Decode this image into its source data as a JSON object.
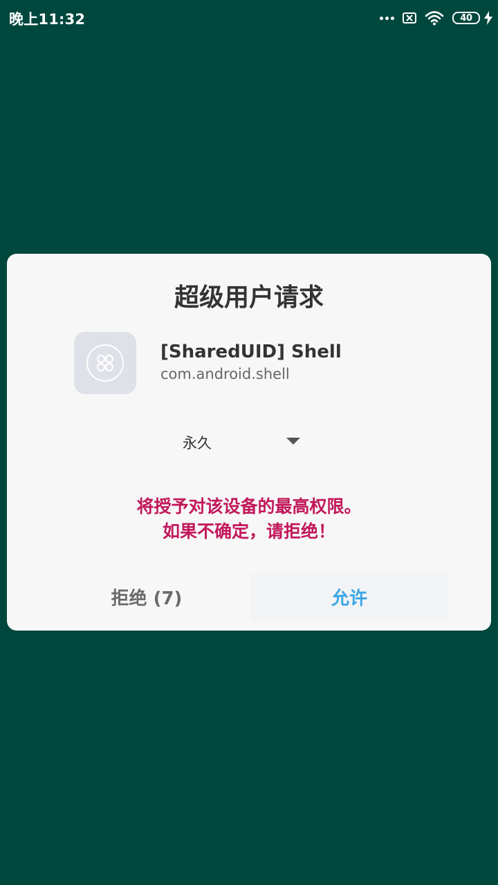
{
  "status_bar": {
    "time": "晚上11:32",
    "battery_level": "40",
    "icons": [
      "more-dots-icon",
      "sim-blocked-icon",
      "wifi-icon",
      "battery-icon",
      "charging-bolt-icon"
    ]
  },
  "dialog": {
    "title": "超级用户请求",
    "app": {
      "name": "[SharedUID] Shell",
      "package": "com.android.shell",
      "icon": "app-grid-icon"
    },
    "duration": {
      "selected": "永久"
    },
    "warning": {
      "line1": "将授予对该设备的最高权限。",
      "line2": "如果不确定，请拒绝！"
    },
    "buttons": {
      "deny": "拒绝 (7)",
      "allow": "允许"
    }
  },
  "colors": {
    "background": "#00473d",
    "dialog_bg": "#f7f7f7",
    "warning": "#c2185b",
    "allow": "#3aa6e6"
  }
}
